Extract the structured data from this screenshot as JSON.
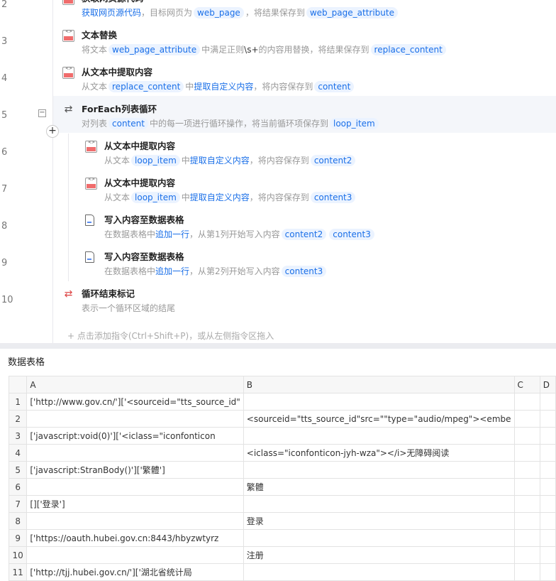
{
  "steps": [
    {
      "line": "2",
      "title": "获取网页源代码",
      "icon": "web-icon",
      "indent": 0,
      "desc": [
        {
          "t": "获取网页源代码",
          "k": "link"
        },
        {
          "t": "，目标网页为",
          "k": "text"
        },
        {
          "t": "web_page",
          "k": "chip"
        },
        {
          "t": "，将结果保存到",
          "k": "text"
        },
        {
          "t": "web_page_attribute",
          "k": "chip"
        }
      ]
    },
    {
      "line": "3",
      "title": "文本替换",
      "icon": "text-icon",
      "indent": 0,
      "desc": [
        {
          "t": "将文本",
          "k": "text"
        },
        {
          "t": "web_page_attribute",
          "k": "chip"
        },
        {
          "t": "中满足正则",
          "k": "text"
        },
        {
          "t": "\\s+",
          "k": "dark"
        },
        {
          "t": "的内容用替换，将结果保存到",
          "k": "text"
        },
        {
          "t": "replace_content",
          "k": "chip"
        }
      ]
    },
    {
      "line": "4",
      "title": "从文本中提取内容",
      "icon": "text-icon",
      "indent": 0,
      "desc": [
        {
          "t": "从文本",
          "k": "text"
        },
        {
          "t": "replace_content",
          "k": "chip"
        },
        {
          "t": "中",
          "k": "text"
        },
        {
          "t": "提取自定义内容",
          "k": "link"
        },
        {
          "t": "，将内容保存到",
          "k": "text"
        },
        {
          "t": "content",
          "k": "chip"
        }
      ]
    },
    {
      "line": "5",
      "title": "ForEach列表循环",
      "icon": "loop-icon",
      "indent": 0,
      "hl": true,
      "desc": [
        {
          "t": "对列表",
          "k": "text"
        },
        {
          "t": "content",
          "k": "chip"
        },
        {
          "t": "中的每一项进行循环操作，将当前循环项保存到",
          "k": "text"
        },
        {
          "t": "loop_item",
          "k": "chip"
        }
      ]
    },
    {
      "line": "6",
      "title": "从文本中提取内容",
      "icon": "text-icon",
      "indent": 1,
      "desc": [
        {
          "t": "从文本",
          "k": "text"
        },
        {
          "t": "loop_item",
          "k": "chip"
        },
        {
          "t": "中",
          "k": "text"
        },
        {
          "t": "提取自定义内容",
          "k": "link"
        },
        {
          "t": "，将内容保存到",
          "k": "text"
        },
        {
          "t": "content2",
          "k": "chip"
        }
      ]
    },
    {
      "line": "7",
      "title": "从文本中提取内容",
      "icon": "text-icon",
      "indent": 1,
      "desc": [
        {
          "t": "从文本",
          "k": "text"
        },
        {
          "t": "loop_item",
          "k": "chip"
        },
        {
          "t": "中",
          "k": "text"
        },
        {
          "t": "提取自定义内容",
          "k": "link"
        },
        {
          "t": "，将内容保存到",
          "k": "text"
        },
        {
          "t": "content3",
          "k": "chip"
        }
      ]
    },
    {
      "line": "8",
      "title": "写入内容至数据表格",
      "icon": "doc-icon",
      "indent": 1,
      "desc": [
        {
          "t": "在数据表格中",
          "k": "text"
        },
        {
          "t": "追加一行",
          "k": "link"
        },
        {
          "t": "，从第1列开始写入内容",
          "k": "text"
        },
        {
          "t": "content2",
          "k": "chip"
        },
        {
          "t": "content3",
          "k": "chip"
        }
      ]
    },
    {
      "line": "9",
      "title": "写入内容至数据表格",
      "icon": "doc-icon",
      "indent": 1,
      "desc": [
        {
          "t": "在数据表格中",
          "k": "text"
        },
        {
          "t": "追加一行",
          "k": "link"
        },
        {
          "t": "，从第2列开始写入内容",
          "k": "text"
        },
        {
          "t": "content3",
          "k": "chip"
        }
      ]
    },
    {
      "line": "10",
      "title": "循环结束标记",
      "icon": "loop-end-icon",
      "indent": 0,
      "desc": [
        {
          "t": "表示一个循环区域的结尾",
          "k": "text"
        }
      ]
    }
  ],
  "add_hint": "+  点击添加指令(Ctrl+Shift+P)，或从左侧指令区拖入",
  "collapse_label": "−",
  "add_label": "+",
  "panel_title": "数据表格",
  "table": {
    "columns": [
      "A",
      "B",
      "C",
      "D"
    ],
    "rows": [
      [
        "1",
        "['http://www.gov.cn/']['<sourceid=\"tts_source_id\"",
        "",
        ""
      ],
      [
        "2",
        "",
        "<sourceid=\"tts_source_id\"src=\"\"type=\"audio/mpeg\"><embe",
        ""
      ],
      [
        "3",
        "['javascript:void(0)']['<iclass=\"iconfonticon",
        "",
        ""
      ],
      [
        "4",
        "",
        "<iclass=\"iconfonticon-jyh-wza\"></i>无障碍阅读",
        ""
      ],
      [
        "5",
        "['javascript:StranBody()']['繁體']",
        "",
        ""
      ],
      [
        "6",
        "",
        "繁體",
        ""
      ],
      [
        "7",
        "[]['登录']",
        "",
        ""
      ],
      [
        "8",
        "",
        "登录",
        ""
      ],
      [
        "9",
        "['https://oauth.hubei.gov.cn:8443/hbyzwtyrz",
        "",
        ""
      ],
      [
        "10",
        "",
        "注册",
        ""
      ],
      [
        "11",
        "['http://tjj.hubei.gov.cn/']['湖北省统计局",
        "",
        ""
      ]
    ]
  }
}
